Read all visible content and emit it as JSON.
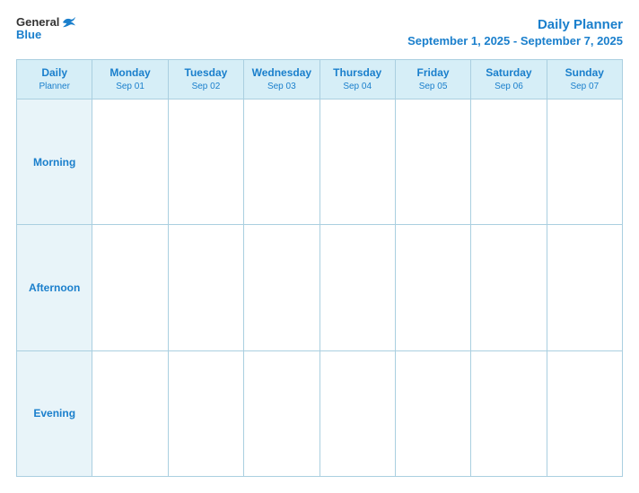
{
  "header": {
    "logo_general": "General",
    "logo_blue": "Blue",
    "title": "Daily Planner",
    "subtitle": "September 1, 2025 - September 7, 2025"
  },
  "table": {
    "label_col_header_line1": "Daily",
    "label_col_header_line2": "Planner",
    "columns": [
      {
        "day": "Monday",
        "date": "Sep 01"
      },
      {
        "day": "Tuesday",
        "date": "Sep 02"
      },
      {
        "day": "Wednesday",
        "date": "Sep 03"
      },
      {
        "day": "Thursday",
        "date": "Sep 04"
      },
      {
        "day": "Friday",
        "date": "Sep 05"
      },
      {
        "day": "Saturday",
        "date": "Sep 06"
      },
      {
        "day": "Sunday",
        "date": "Sep 07"
      }
    ],
    "rows": [
      {
        "label": "Morning"
      },
      {
        "label": "Afternoon"
      },
      {
        "label": "Evening"
      }
    ]
  }
}
